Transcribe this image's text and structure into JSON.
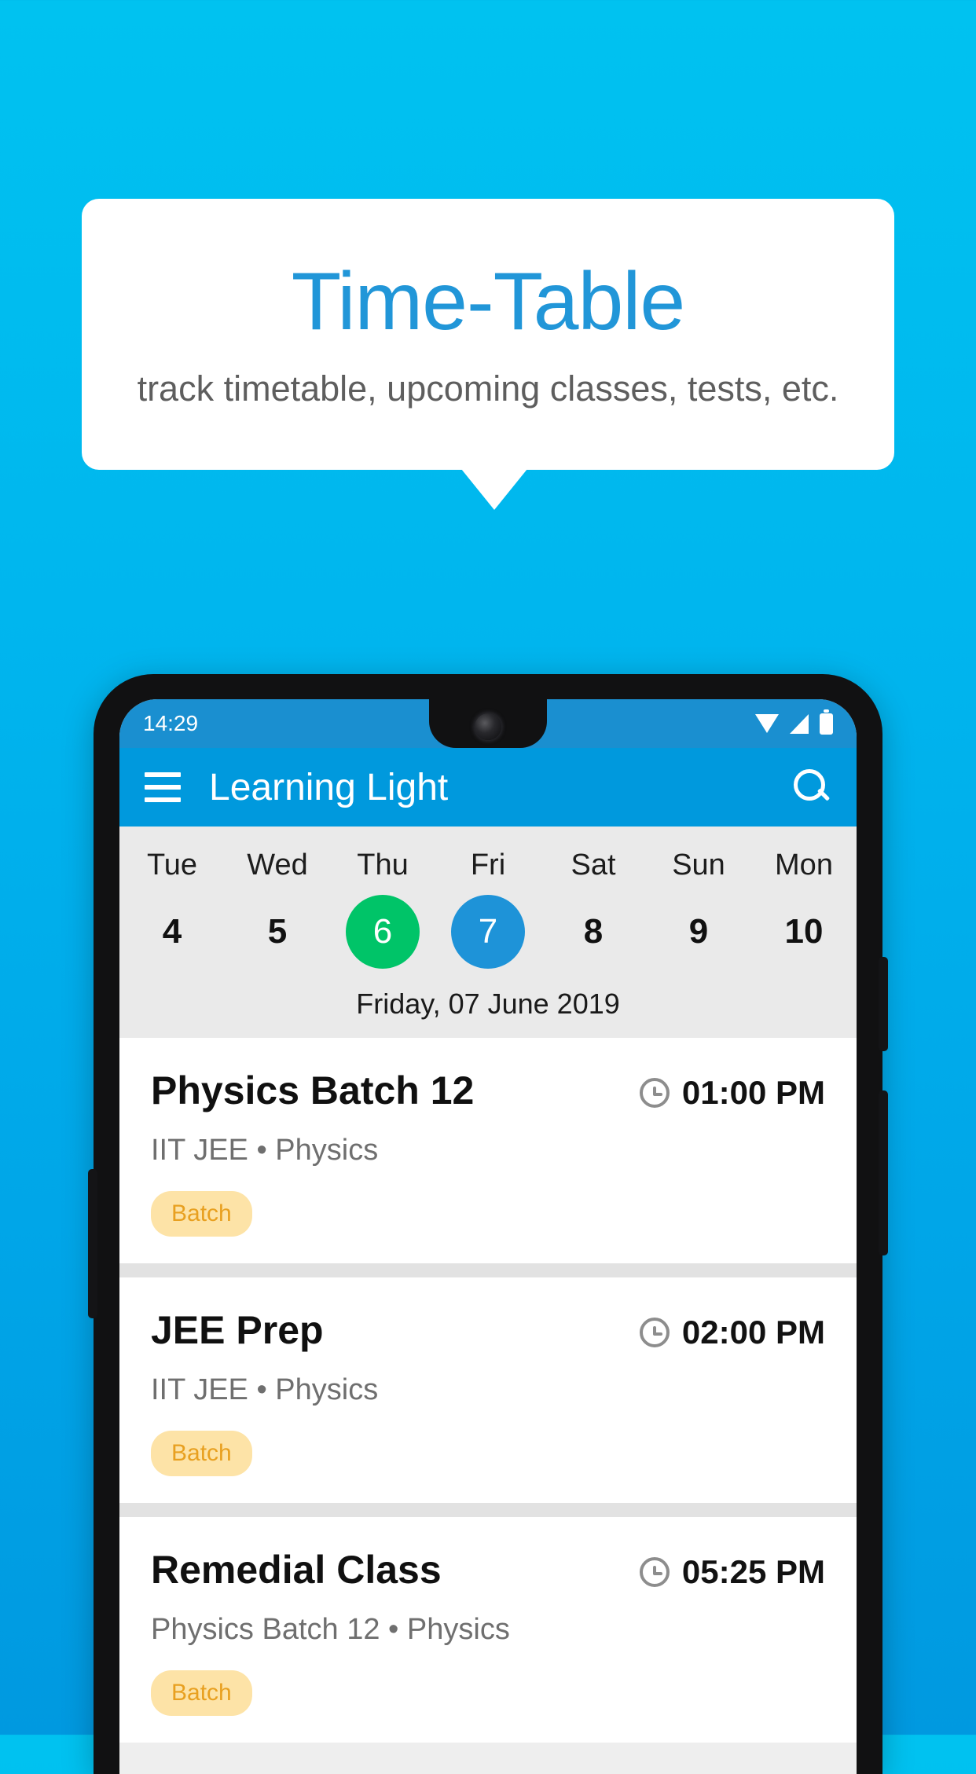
{
  "promo": {
    "title": "Time-Table",
    "subtitle": "track timetable, upcoming classes, tests, etc.",
    "background_color": "#00b6ee",
    "title_color": "#2196d8"
  },
  "phone": {
    "status_bar": {
      "time": "14:29",
      "icons": [
        "wifi-icon",
        "signal-icon",
        "battery-icon"
      ]
    },
    "app_bar": {
      "menu_icon": "hamburger-icon",
      "title": "Learning Light",
      "search_icon": "search-icon",
      "color": "#0099dd"
    },
    "day_strip": {
      "days": [
        {
          "name": "Tue",
          "num": "4",
          "state": "normal"
        },
        {
          "name": "Wed",
          "num": "5",
          "state": "normal"
        },
        {
          "name": "Thu",
          "num": "6",
          "state": "today"
        },
        {
          "name": "Fri",
          "num": "7",
          "state": "selected"
        },
        {
          "name": "Sat",
          "num": "8",
          "state": "normal"
        },
        {
          "name": "Sun",
          "num": "9",
          "state": "normal"
        },
        {
          "name": "Mon",
          "num": "10",
          "state": "normal"
        }
      ],
      "today_color": "#00c468",
      "selected_color": "#1e93d8",
      "selected_date_label": "Friday, 07 June 2019"
    },
    "classes": [
      {
        "title": "Physics Batch 12",
        "time": "01:00 PM",
        "subtitle": "IIT JEE • Physics",
        "badge": "Batch"
      },
      {
        "title": "JEE Prep",
        "time": "02:00 PM",
        "subtitle": "IIT JEE • Physics",
        "badge": "Batch"
      },
      {
        "title": "Remedial Class",
        "time": "05:25 PM",
        "subtitle": "Physics Batch 12 • Physics",
        "badge": "Batch"
      }
    ]
  }
}
